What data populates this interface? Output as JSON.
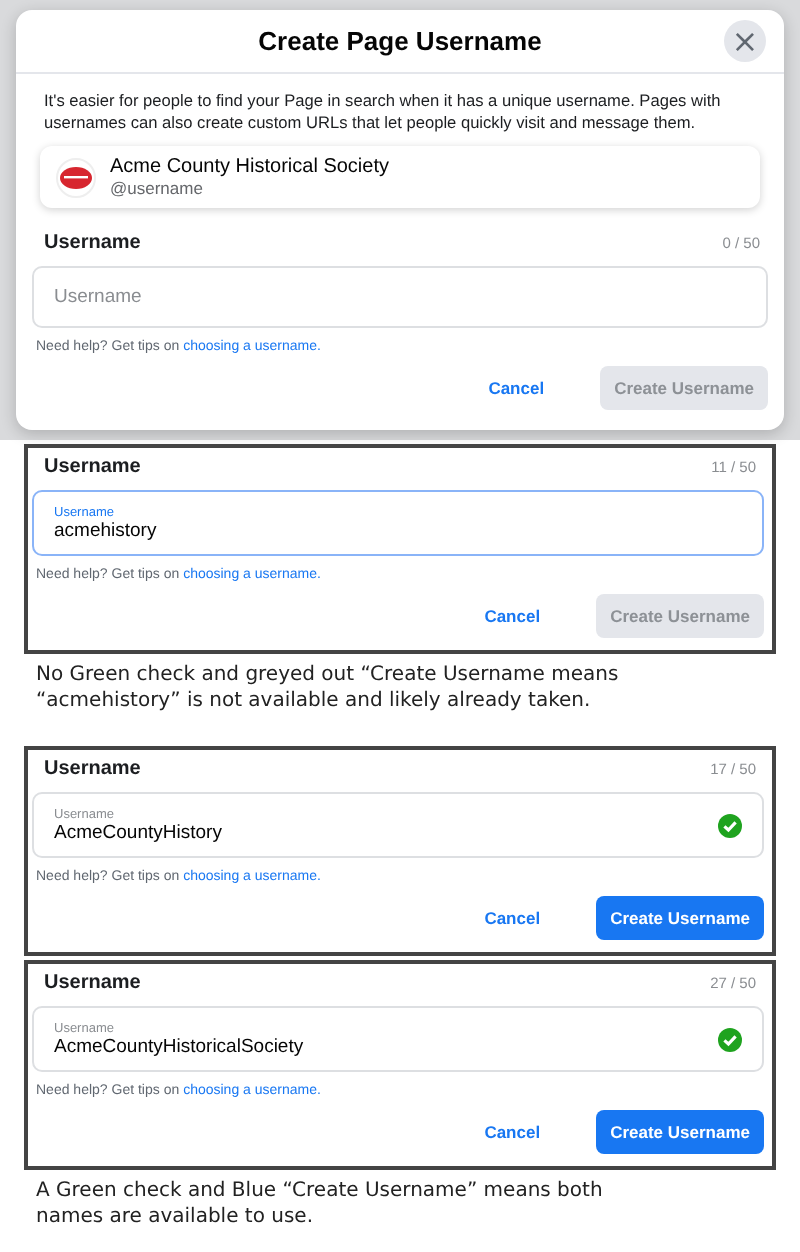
{
  "dialog": {
    "title": "Create Page Username",
    "close": "×",
    "intro": "It's easier for people to find your Page in search when it has a unique username. Pages with usernames can also create custom URLs that let people quickly visit and message them.",
    "page": {
      "name": "Acme County Historical Society",
      "handle": "@username"
    },
    "field": {
      "heading": "Username",
      "counter": "0 / 50",
      "placeholder": "Username",
      "focused": false,
      "available": false,
      "help_prefix": "Need help? Get tips on ",
      "help_link": "choosing a username.",
      "cancel": "Cancel",
      "create": "Create Username",
      "disabled": true
    }
  },
  "blocks": [
    {
      "kind": "panel",
      "heading": "Username",
      "counter": "11 / 50",
      "label": "Username",
      "value": "acmehistory",
      "focused": true,
      "available": false,
      "help_prefix": "Need help? Get tips on ",
      "help_link": "choosing a username.",
      "cancel": "Cancel",
      "create": "Create Username",
      "disabled": true
    },
    {
      "kind": "caption",
      "text": "No Green check and greyed out “Create Username means “acmehistory” is not available and likely already taken."
    },
    {
      "kind": "panel",
      "heading": "Username",
      "counter": "17 / 50",
      "label": "Username",
      "value": "AcmeCountyHistory",
      "focused": false,
      "available": true,
      "help_prefix": "Need help? Get tips on ",
      "help_link": "choosing a username.",
      "cancel": "Cancel",
      "create": "Create Username",
      "disabled": false
    },
    {
      "kind": "panel",
      "heading": "Username",
      "counter": "27 / 50",
      "label": "Username",
      "value": "AcmeCountyHistoricalSociety",
      "focused": false,
      "available": true,
      "help_prefix": "Need help? Get tips on ",
      "help_link": "choosing a username.",
      "cancel": "Cancel",
      "create": "Create Username",
      "disabled": false
    },
    {
      "kind": "caption",
      "text": "A Green check and Blue “Create Username” means both names are available to use."
    }
  ]
}
